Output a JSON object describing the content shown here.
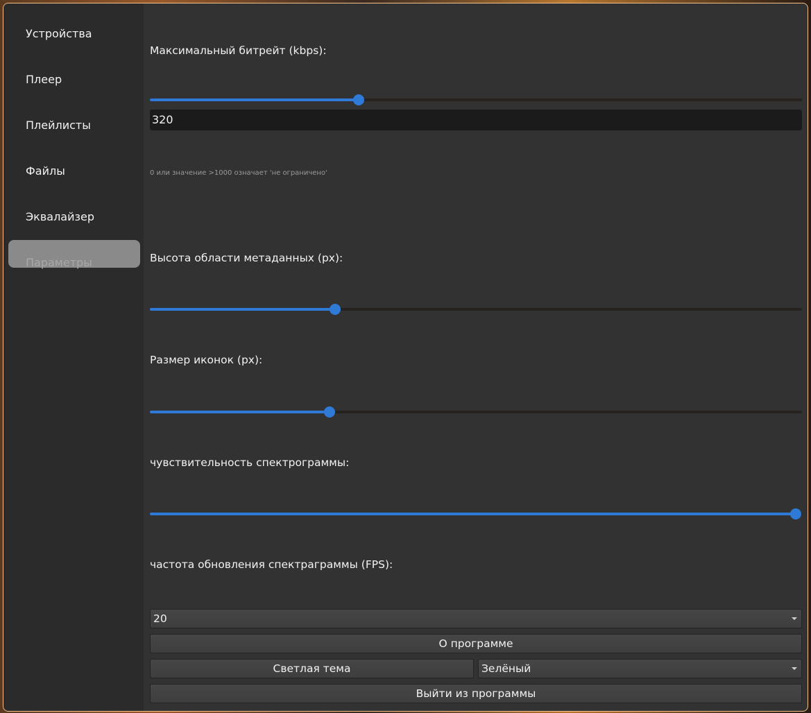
{
  "sidebar": {
    "items": [
      {
        "label": "Устройства"
      },
      {
        "label": "Плеер"
      },
      {
        "label": "Плейлисты"
      },
      {
        "label": "Файлы"
      },
      {
        "label": "Эквалайзер"
      },
      {
        "label": "Параметры",
        "active": true
      }
    ]
  },
  "settings": {
    "bitrate": {
      "label": "Максимальный битрейт (kbps):",
      "value": "320",
      "slider_fraction": 0.32,
      "hint": "0 или значение >1000 означает 'не ограничено'"
    },
    "metadata_height": {
      "label": "Высота области метаданных (px):",
      "slider_fraction": 0.284
    },
    "icon_size": {
      "label": "Размер иконок (px):",
      "slider_fraction": 0.276
    },
    "spectrogram_sensitivity": {
      "label": "чувствительность спектрограммы:",
      "slider_fraction": 0.99
    },
    "spectrogram_fps": {
      "label": "частота обновления спектраграммы (FPS):",
      "selected": "20"
    }
  },
  "buttons": {
    "about": "О программе",
    "light_theme": "Светлая тема",
    "accent_color": "Зелёный",
    "exit": "Выйти из программы"
  },
  "colors": {
    "accent": "#2f7ad6",
    "window_border": "#f6c18e"
  },
  "icons": {
    "combo_arrow": "chevron-down-icon"
  }
}
